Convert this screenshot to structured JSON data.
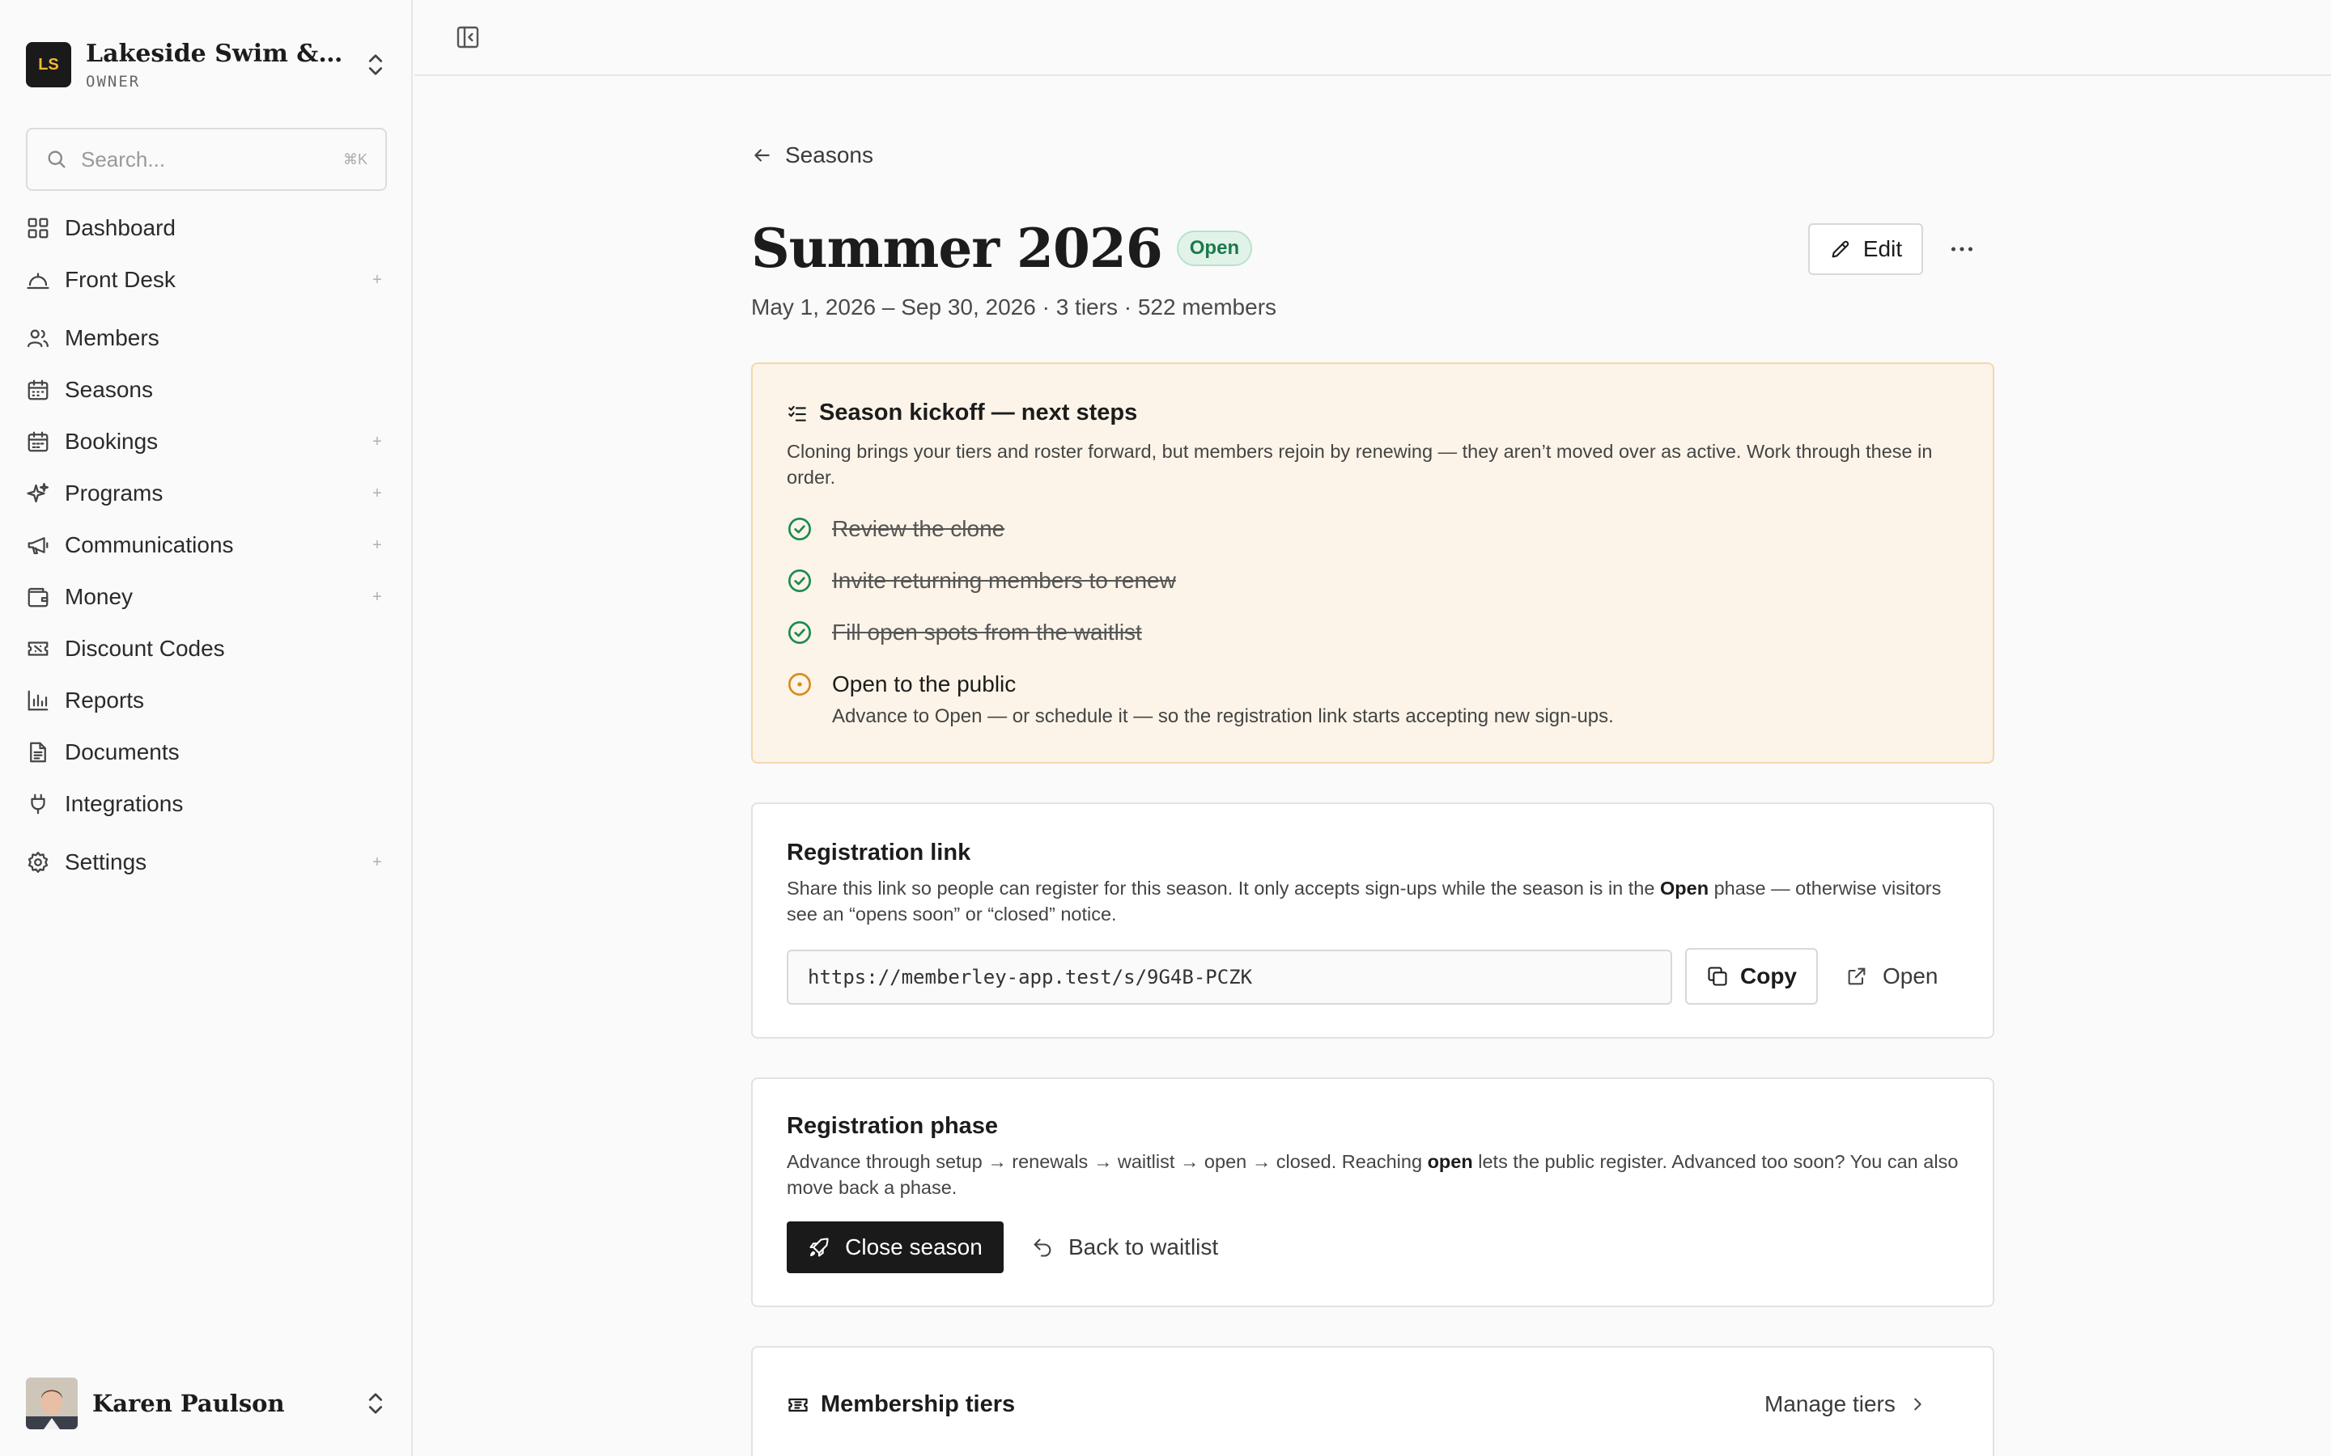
{
  "org": {
    "initials": "LS",
    "name": "Lakeside Swim & Tennis Club",
    "role": "OWNER"
  },
  "search": {
    "placeholder": "Search...",
    "shortcut": "⌘K"
  },
  "nav": {
    "items": [
      {
        "label": "Dashboard",
        "icon": "grid-icon",
        "expandable": false
      },
      {
        "label": "Front Desk",
        "icon": "bell-desk-icon",
        "expandable": true
      },
      {
        "label": "Members",
        "icon": "users-icon",
        "expandable": false
      },
      {
        "label": "Seasons",
        "icon": "calendar-grid-icon",
        "expandable": false
      },
      {
        "label": "Bookings",
        "icon": "calendar-icon",
        "expandable": true
      },
      {
        "label": "Programs",
        "icon": "sparkles-icon",
        "expandable": true
      },
      {
        "label": "Communications",
        "icon": "megaphone-icon",
        "expandable": true
      },
      {
        "label": "Money",
        "icon": "wallet-icon",
        "expandable": true
      },
      {
        "label": "Discount Codes",
        "icon": "ticket-icon",
        "expandable": false
      },
      {
        "label": "Reports",
        "icon": "bar-chart-icon",
        "expandable": false
      },
      {
        "label": "Documents",
        "icon": "document-icon",
        "expandable": false
      },
      {
        "label": "Integrations",
        "icon": "plug-icon",
        "expandable": false
      },
      {
        "label": "Settings",
        "icon": "gear-icon",
        "expandable": true
      }
    ],
    "plus_glyph": "+"
  },
  "user": {
    "name": "Karen Paulson"
  },
  "header": {
    "back_label": "Seasons",
    "title": "Summer 2026",
    "status": "Open",
    "subtitle": "May 1, 2026 – Sep 30, 2026 · 3 tiers · 522 members",
    "edit_label": "Edit",
    "more_glyph": "···"
  },
  "next_steps": {
    "title": "Season kickoff — next steps",
    "description": "Cloning brings your tiers and roster forward, but members rejoin by renewing — they aren’t moved over as active. Work through these in order.",
    "steps": [
      {
        "label": "Review the clone",
        "done": true
      },
      {
        "label": "Invite returning members to renew",
        "done": true
      },
      {
        "label": "Fill open spots from the waitlist",
        "done": true
      },
      {
        "label": "Open to the public",
        "done": false
      }
    ],
    "current_step_description": "Advance to Open — or schedule it — so the registration link starts accepting new sign-ups."
  },
  "registration_link": {
    "title": "Registration link",
    "description_before": "Share this link so people can register for this season. It only accepts sign-ups while the season is in the ",
    "description_bold": "Open",
    "description_after": " phase — otherwise visitors see an “opens soon” or “closed” notice.",
    "url": "https://memberley-app.test/s/9G4B-PCZK",
    "copy_label": "Copy",
    "open_label": "Open"
  },
  "registration_phase": {
    "title": "Registration phase",
    "description_before": "Advance through setup → renewals → waitlist → open → closed. Reaching ",
    "description_bold": "open",
    "description_after": " lets the public register. Advanced too soon? You can also move back a phase.",
    "primary_label": "Close season",
    "secondary_label": "Back to waitlist"
  },
  "tiers": {
    "title": "Membership tiers",
    "manage_label": "Manage tiers"
  },
  "colors": {
    "accent_green": "#1a7a4c",
    "warning_orange": "#d98a1c",
    "primary_dark": "#1a1a1a"
  }
}
